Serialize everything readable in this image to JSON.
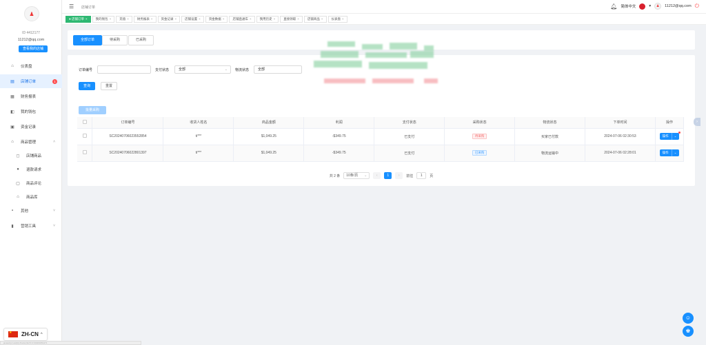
{
  "sidebar": {
    "avatar_glyph": "♟",
    "uid": "ID 4412177",
    "email": "11212@qq.com",
    "shop_button": "查看我的店铺",
    "items": [
      {
        "label": "仪表盘",
        "icon": "home-icon"
      },
      {
        "label": "店铺订单",
        "icon": "document-icon",
        "badge": "1"
      },
      {
        "label": "财务报表",
        "icon": "table-icon"
      },
      {
        "label": "我的钱包",
        "icon": "wallet-icon"
      },
      {
        "label": "资金记录",
        "icon": "record-icon"
      },
      {
        "label": "商品管理",
        "icon": "shop-icon"
      },
      {
        "label": "店铺商品",
        "icon": "bag-icon"
      },
      {
        "label": "退款请求",
        "icon": "question-icon"
      },
      {
        "label": "商品评论",
        "icon": "comment-icon"
      },
      {
        "label": "商品库",
        "icon": "home-icon"
      },
      {
        "label": "其他",
        "icon": "grid-icon"
      },
      {
        "label": "营销工具",
        "icon": "bar-chart-icon"
      }
    ]
  },
  "language": {
    "code": "ZH-CN"
  },
  "status_bar_url": "javascript:void(0)  #/order/list?t=1720260451271",
  "header": {
    "breadcrumb": "店铺订单",
    "language_label": "简体中文",
    "email": "11212@qq.com"
  },
  "tabs": [
    "店铺订单",
    "我的钱包",
    "充值",
    "财务报表",
    "资金记录",
    "店铺设置",
    "资金数据",
    "店铺直通车",
    "我用历史",
    "直接领取",
    "店铺商品",
    "仪表盘"
  ],
  "status_tabs": [
    "全部订单",
    "待采购",
    "已采购"
  ],
  "filters": {
    "order_no_label": "订单编号",
    "order_no_value": "",
    "pay_status_label": "支付状态",
    "pay_status_value": "全部",
    "logistics_label": "物流状态",
    "logistics_value": "全部",
    "search_button": "查询",
    "reset_button": "重置",
    "batch_button": "批量采购"
  },
  "table": {
    "headers": [
      "订单编号",
      "收货人姓名",
      "商品金额",
      "利润",
      "支付状态",
      "采购状态",
      "物流状态",
      "下单时间",
      "操作"
    ],
    "rows": [
      {
        "order_no": "SC2024070602355285​4",
        "name": "ti***",
        "amount": "$1,049.25",
        "profit": "-$349.75",
        "pay": "已支付",
        "purchase": "待采购",
        "logistics": "买家已付款",
        "time": "2024-07-06 02:30:53",
        "action": "操作"
      },
      {
        "order_no": "SC2024070602280139​7",
        "name": "ti***",
        "amount": "$1,049.25",
        "profit": "-$349.75",
        "pay": "已支付",
        "purchase": "已采购",
        "logistics": "物流运输中",
        "time": "2024-07-06 02:28:01",
        "action": "操作"
      }
    ]
  },
  "pagination": {
    "total": "共 2 条",
    "page_size": "10条/页",
    "current": "1",
    "goto_label": "前往",
    "goto_value": "1",
    "page_suffix": "页"
  }
}
